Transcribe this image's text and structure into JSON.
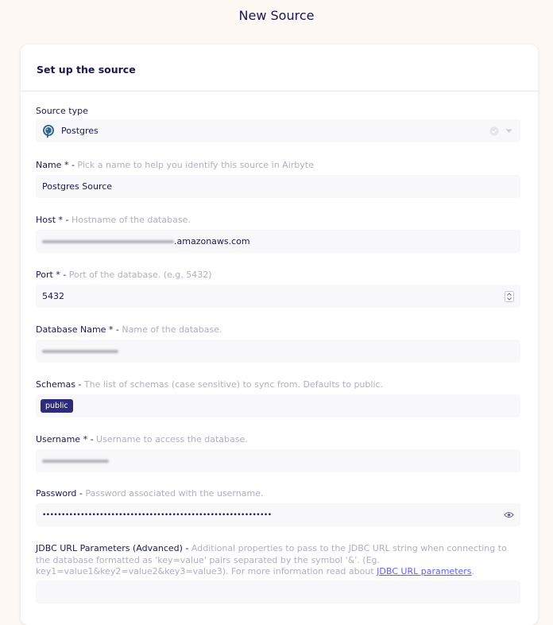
{
  "page": {
    "title": "New Source"
  },
  "card": {
    "header": "Set up the source"
  },
  "source_type": {
    "label": "Source type",
    "value": "Postgres",
    "icon": "postgres-elephant-icon"
  },
  "fields": {
    "name": {
      "label": "Name * - ",
      "hint": "Pick a name to help you identify this source in Airbyte",
      "value": "Postgres Source"
    },
    "host": {
      "label": "Host * - ",
      "hint": "Hostname of the database.",
      "value_suffix": ".amazonaws.com"
    },
    "port": {
      "label": "Port * - ",
      "hint": "Port of the database. (e.g. 5432)",
      "value": "5432"
    },
    "database": {
      "label": "Database Name * - ",
      "hint": "Name of the database."
    },
    "schemas": {
      "label": "Schemas - ",
      "hint": "The list of schemas (case sensitive) to sync from. Defaults to public.",
      "chips": [
        "public"
      ]
    },
    "username": {
      "label": "Username * - ",
      "hint": "Username to access the database."
    },
    "password": {
      "label": "Password - ",
      "hint": "Password associated with the username.",
      "value": "••••••••••••••••••••••••••••••••••••••••••••••••••••••••••••"
    },
    "jdbc": {
      "label": "JDBC URL Parameters (Advanced) - ",
      "hint": "Additional properties to pass to the JDBC URL string when connecting to the database formatted as 'key=value' pairs separated by the symbol '&'. (Eg. key1=value1&key2=value2&key3=value3). For more information read about ",
      "link": "JDBC URL parameters",
      "hint_end": "."
    }
  },
  "colors": {
    "accent": "#2e2c7a",
    "text": "#1a194d",
    "hint": "#afafc1",
    "input_bg": "#f8f8fa",
    "link": "#615eff"
  }
}
